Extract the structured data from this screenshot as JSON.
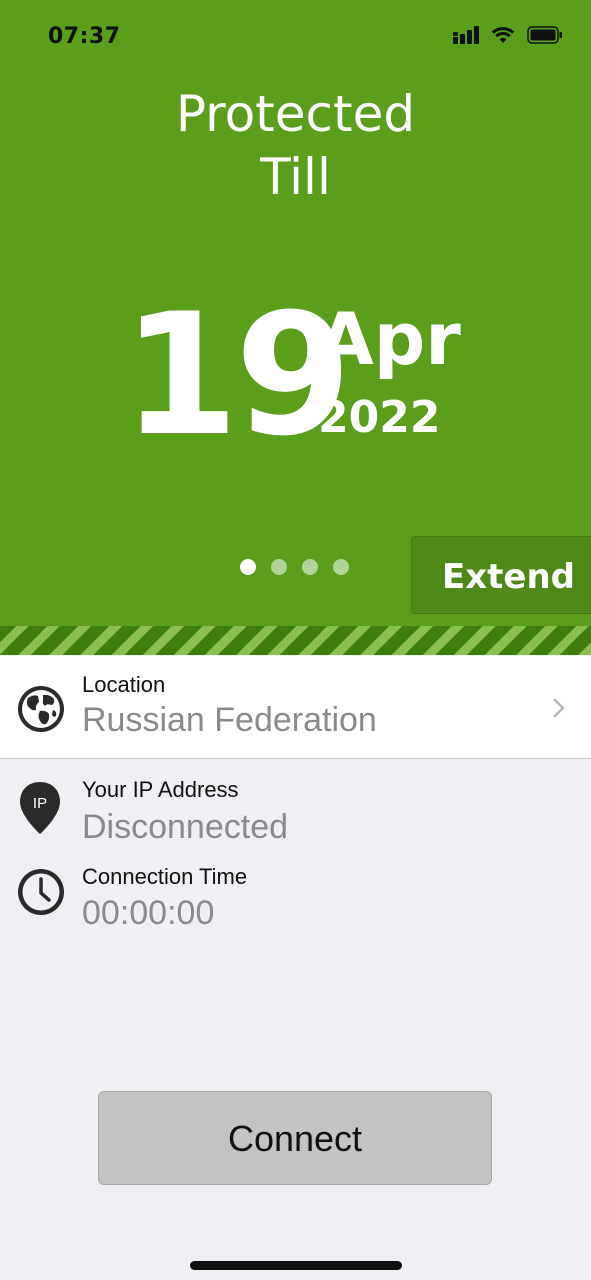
{
  "status_bar": {
    "time": "07:37"
  },
  "hero": {
    "title_line1": "Protected",
    "title_line2": "Till",
    "day": "19",
    "month": "Apr",
    "year": "2022",
    "extend_label": "Extend",
    "page_count": 4,
    "active_page": 1
  },
  "location": {
    "label": "Location",
    "value": "Russian Federation"
  },
  "ip": {
    "label": "Your IP Address",
    "value": "Disconnected",
    "badge": "IP"
  },
  "connection_time": {
    "label": "Connection Time",
    "value": "00:00:00"
  },
  "connect_label": "Connect",
  "colors": {
    "brand_green": "#5a9e1b",
    "background": "#efeff4"
  }
}
